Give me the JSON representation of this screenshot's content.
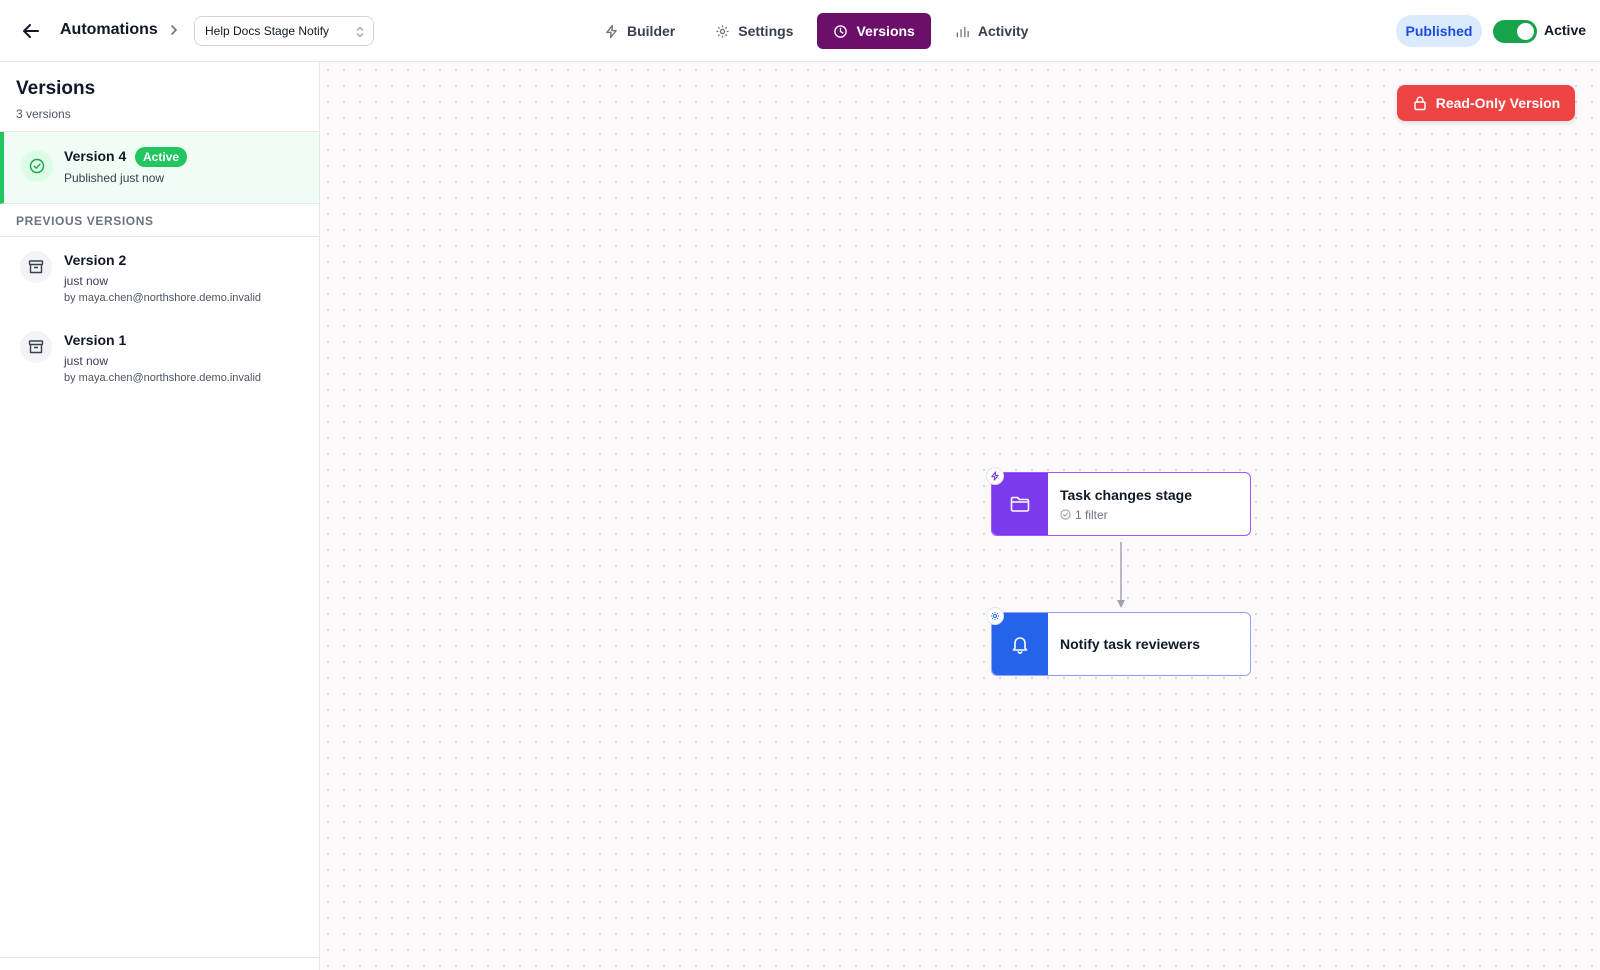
{
  "header": {
    "title": "Automations",
    "automation_selector": "Help Docs Stage Notify",
    "tabs": [
      {
        "label": "Builder",
        "icon": "bolt-icon"
      },
      {
        "label": "Settings",
        "icon": "gear-icon"
      },
      {
        "label": "Versions",
        "icon": "clock-icon",
        "active": true
      },
      {
        "label": "Activity",
        "icon": "bar-chart-icon"
      }
    ],
    "status_badge": "Published",
    "toggle_label": "Active",
    "toggle_on": true
  },
  "sidebar": {
    "title": "Versions",
    "count": "3 versions",
    "current": {
      "name": "Version 4",
      "badge": "Active",
      "subtitle": "Published just now"
    },
    "previous_header": "PREVIOUS VERSIONS",
    "previous": [
      {
        "name": "Version 2",
        "when": "just now",
        "by": "by maya.chen@northshore.demo.invalid"
      },
      {
        "name": "Version 1",
        "when": "just now",
        "by": "by maya.chen@northshore.demo.invalid"
      }
    ]
  },
  "canvas": {
    "readonly_label": "Read-Only Version",
    "nodes": [
      {
        "title": "Task changes stage",
        "subtitle": "1 filter",
        "type": "trigger"
      },
      {
        "title": "Notify task reviewers",
        "subtitle": "",
        "type": "action"
      }
    ]
  },
  "colors": {
    "accent": "#6b0f6b",
    "active_green": "#22c55e",
    "danger": "#ef4444",
    "trigger": "#7c3aed",
    "action": "#2563eb"
  }
}
